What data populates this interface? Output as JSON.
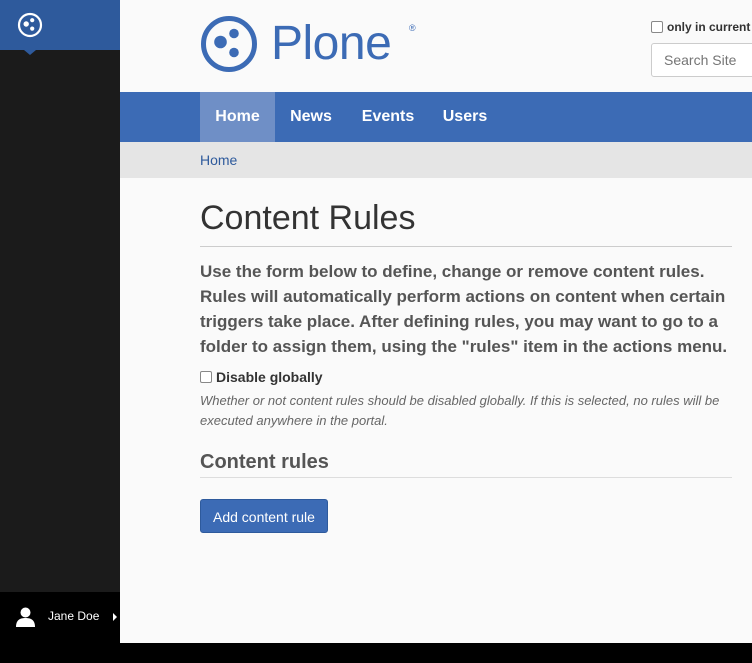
{
  "colors": {
    "plone_blue": "#3c6bb5",
    "toolbar_dark": "#1b1b1b",
    "toolbar_accent": "#2e5a9c",
    "nav_active": "#6f8fc6"
  },
  "toolbar": {
    "logo_icon": "plone-logo-icon",
    "user": {
      "icon": "user-icon",
      "name": "Jane Doe"
    }
  },
  "header": {
    "logo_text": "Plone",
    "logo_reg": "®",
    "search_current_label": "only in current s",
    "search_placeholder": "Search Site"
  },
  "nav": {
    "items": [
      {
        "label": "Home",
        "active": true
      },
      {
        "label": "News",
        "active": false
      },
      {
        "label": "Events",
        "active": false
      },
      {
        "label": "Users",
        "active": false
      }
    ]
  },
  "breadcrumbs": {
    "home": "Home"
  },
  "content": {
    "title": "Content Rules",
    "description": "Use the form below to define, change or remove content rules. Rules will automatically perform actions on content when certain triggers take place. After defining rules, you may want to go to a folder to assign them, using the \"rules\" item in the actions menu.",
    "disable_globally_label": "Disable globally",
    "disable_globally_checked": false,
    "disable_globally_help": "Whether or not content rules should be disabled globally. If this is selected, no rules will be executed anywhere in the portal.",
    "section_title": "Content rules",
    "add_button": "Add content rule"
  }
}
